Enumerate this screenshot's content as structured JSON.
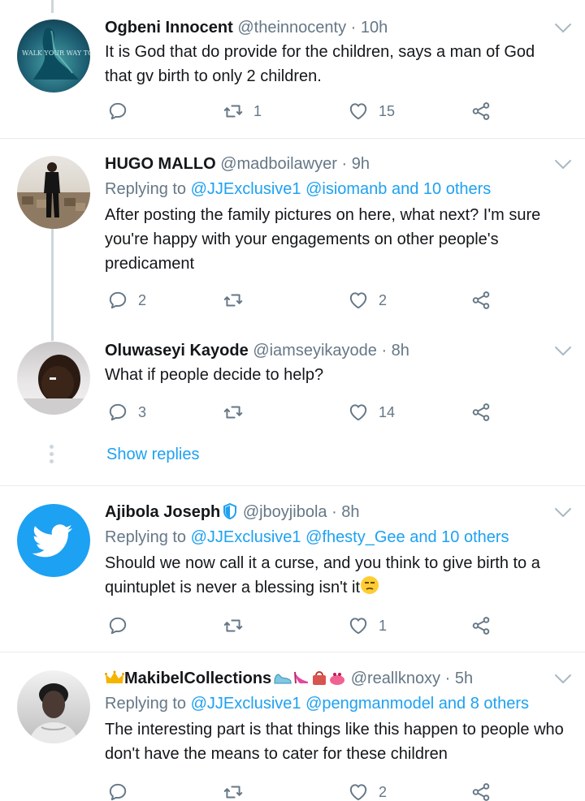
{
  "colors": {
    "accent": "#1da1f2",
    "secondary": "#657786",
    "text": "#14171a",
    "divider": "#e6ecf0",
    "thread": "#ccd6dd"
  },
  "tweets": [
    {
      "name": "Ogbeni Innocent",
      "handle": "@theinnocenty",
      "time": "· 10h",
      "replying": null,
      "text": "It is God that do provide for the children, says a man of God that gv birth to only 2 children.",
      "avatar_text": "WALK YOUR WAY TO THE TOP",
      "actions": {
        "reply": "",
        "retweet": "1",
        "like": "15"
      }
    },
    {
      "name": "HUGO MALLO",
      "handle": "@madboilawyer",
      "time": "· 9h",
      "replying": {
        "prefix": "Replying to",
        "mentions": "@JJExclusive1 @isiomanb and 10 others"
      },
      "text": "After posting the family pictures on here, what next? I'm sure you're happy with your engagements on other people's predicament",
      "actions": {
        "reply": "2",
        "retweet": "",
        "like": "2"
      }
    },
    {
      "name": "Oluwaseyi Kayode",
      "handle": "@iamseyikayode",
      "time": "· 8h",
      "replying": null,
      "text": "What if people decide to help?",
      "actions": {
        "reply": "3",
        "retweet": "",
        "like": "14"
      },
      "show_replies": "Show replies"
    },
    {
      "name": "Ajibola Joseph",
      "handle": "@jboyjibola",
      "time": "· 8h",
      "replying": {
        "prefix": "Replying to",
        "mentions": "@JJExclusive1 @fhesty_Gee and 10 others"
      },
      "text": "Should we now call it a curse, and you think to give birth to a quintuplet is never a blessing isn't it",
      "actions": {
        "reply": "",
        "retweet": "",
        "like": "1"
      }
    },
    {
      "name": "MakibelCollections",
      "handle": "@reallknoxy",
      "time": "· 5h",
      "replying": {
        "prefix": "Replying to",
        "mentions": "@JJExclusive1 @pengmanmodel and 8 others"
      },
      "text": "The interesting part is that things like this happen to people who don't have the means to cater for these children",
      "actions": {
        "reply": "",
        "retweet": "",
        "like": "2"
      }
    }
  ]
}
